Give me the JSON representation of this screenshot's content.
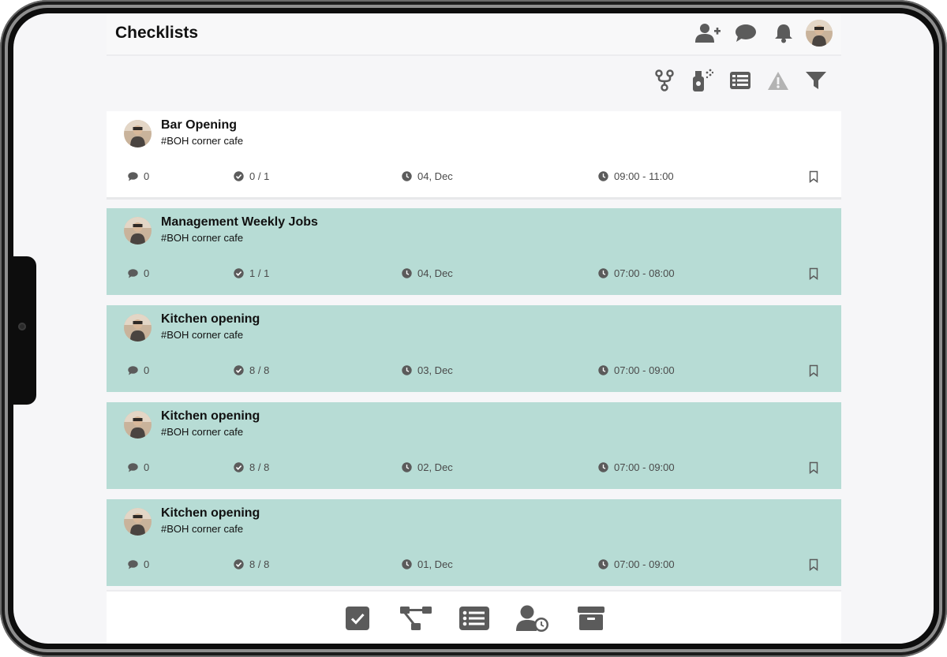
{
  "header": {
    "title": "Checklists",
    "icons": [
      "add-user-icon",
      "chat-icon",
      "bell-icon",
      "user-avatar"
    ]
  },
  "toolbar": {
    "icons": [
      "fork-icon",
      "spray-icon",
      "list-view-icon",
      "warning-icon",
      "filter-icon"
    ]
  },
  "checklists": [
    {
      "title": "Bar Opening",
      "location": "#BOH corner cafe",
      "comments": "0",
      "tasks": "0 / 1",
      "date": "04, Dec",
      "time": "09:00 - 11:00",
      "completed": false
    },
    {
      "title": "Management Weekly Jobs",
      "location": "#BOH corner cafe",
      "comments": "0",
      "tasks": "1 / 1",
      "date": "04, Dec",
      "time": "07:00 - 08:00",
      "completed": true
    },
    {
      "title": "Kitchen opening",
      "location": "#BOH corner cafe",
      "comments": "0",
      "tasks": "8 / 8",
      "date": "03, Dec",
      "time": "07:00 - 09:00",
      "completed": true
    },
    {
      "title": "Kitchen opening",
      "location": "#BOH corner cafe",
      "comments": "0",
      "tasks": "8 / 8",
      "date": "02, Dec",
      "time": "07:00 - 09:00",
      "completed": true
    },
    {
      "title": "Kitchen opening",
      "location": "#BOH corner cafe",
      "comments": "0",
      "tasks": "8 / 8",
      "date": "01, Dec",
      "time": "07:00 - 09:00",
      "completed": true
    }
  ],
  "bottom_nav": {
    "icons": [
      "checklist-icon",
      "workflow-icon",
      "list-icon",
      "user-clock-icon",
      "archive-icon"
    ]
  },
  "colors": {
    "completed_card": "#b7dcd5",
    "icon_gray": "#5b5b5b"
  }
}
